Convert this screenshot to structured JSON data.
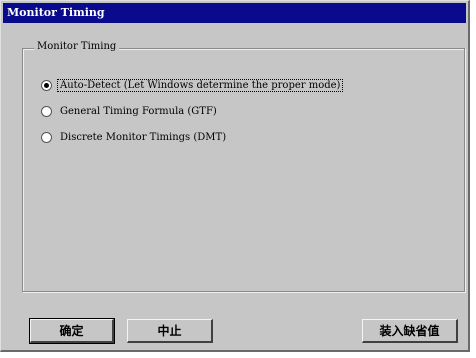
{
  "window": {
    "title": "Monitor Timing"
  },
  "group": {
    "label": "Monitor Timing",
    "options": [
      {
        "label": "Auto-Detect (Let Windows determine the proper mode)",
        "selected": true
      },
      {
        "label": "General Timing Formula (GTF)",
        "selected": false
      },
      {
        "label": "Discrete Monitor Timings (DMT)",
        "selected": false
      }
    ]
  },
  "buttons": {
    "ok_label": "确定",
    "cancel_label": "中止",
    "defaults_label": "装入缺省值"
  }
}
